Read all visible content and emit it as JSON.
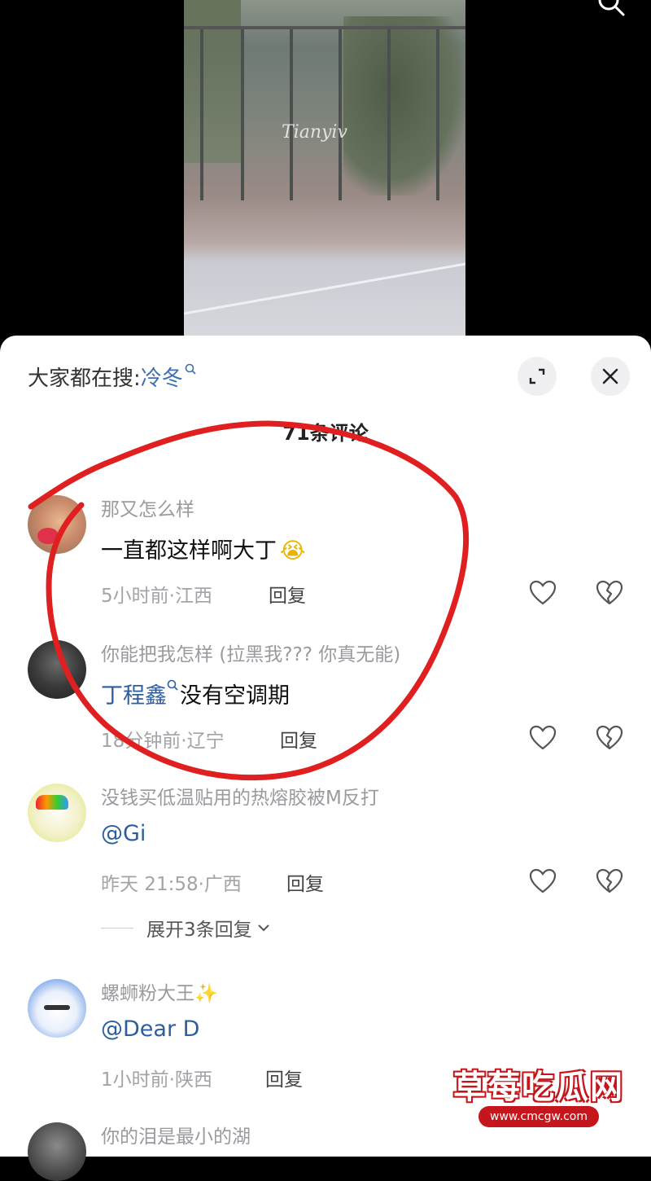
{
  "video": {
    "watermark": "Tianyiv"
  },
  "header": {
    "hot_search_label": "大家都在搜:",
    "hot_search_keyword": "冷冬",
    "comment_count_title": "71条评论"
  },
  "comments": [
    {
      "username": "那又怎么样",
      "text": "一直都这样啊大丁",
      "emoji": "😭",
      "time": "5小时前",
      "region": "江西",
      "reply": "回复"
    },
    {
      "username": "你能把我怎样 (拉黑我??? 你真无能)",
      "mention": "丁程鑫",
      "text": "没有空调期",
      "time": "18分钟前",
      "region": "辽宁",
      "reply": "回复"
    },
    {
      "username": "没钱买低温贴用的热熔胶被M反打",
      "text": "@Gi",
      "time": "昨天 21:58",
      "region": "广西",
      "reply": "回复",
      "expand": "展开3条回复"
    },
    {
      "username": "螺蛳粉大王",
      "username_emoji": "✨",
      "text": "@Dear D",
      "time": "1小时前",
      "region": "陕西",
      "reply": "回复"
    },
    {
      "username": "你的泪是最小的湖"
    }
  ],
  "meta_separator": "·",
  "watermark_badge": {
    "title": "草莓吃瓜网",
    "url": "www.cmcgw.com"
  },
  "colors": {
    "mention": "#2c5e9e",
    "keyword": "#3d6fb0",
    "annotation": "#e02020",
    "badge": "#c4161c"
  },
  "icons": [
    "search-icon",
    "expand-icon",
    "close-icon",
    "heart-outline-icon",
    "broken-heart-icon",
    "chevron-down-icon"
  ]
}
